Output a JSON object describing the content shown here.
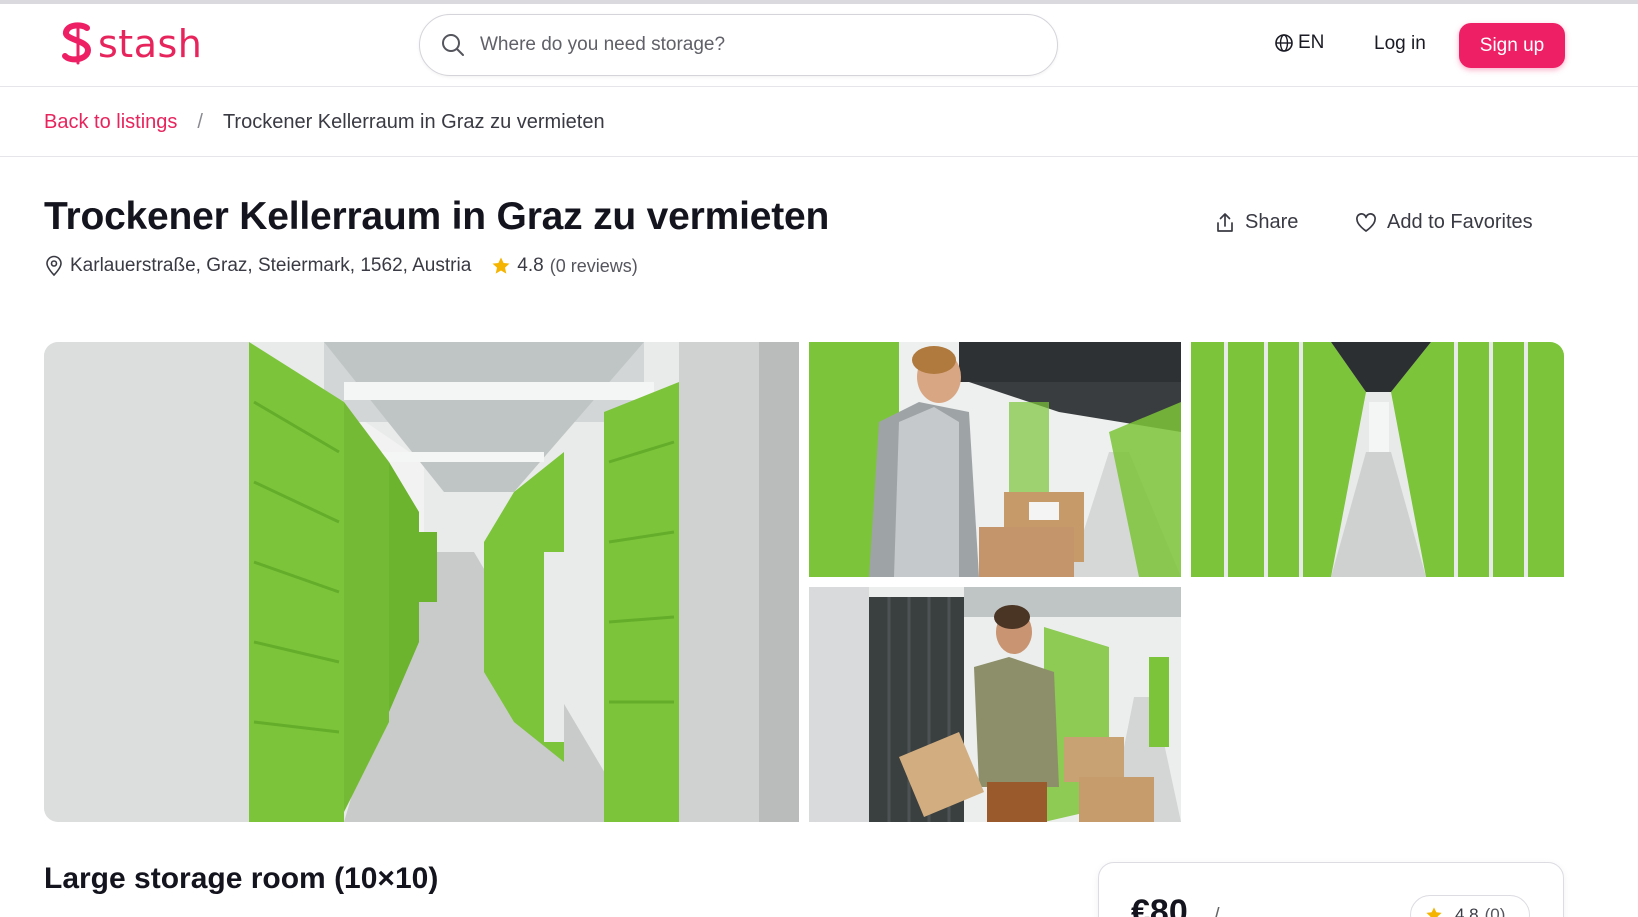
{
  "brand": {
    "name": "stash",
    "color": "#ee1f65"
  },
  "search": {
    "placeholder": "Where do you need storage?"
  },
  "header": {
    "language": "EN",
    "login_label": "Log in",
    "signup_label": "Sign up"
  },
  "breadcrumb": {
    "back_label": "Back to listings",
    "separator": "/",
    "current": "Trockener Kellerraum in Graz zu vermieten"
  },
  "listing": {
    "title": "Trockener Kellerraum in Graz zu vermieten",
    "address": "Karlauerstraße, Graz, Steiermark, 1562, Austria",
    "rating": "4.8",
    "reviews": "(0 reviews)",
    "share_label": "Share",
    "favorite_label": "Add to Favorites",
    "unit_title": "Large storage room (10×10)"
  },
  "gallery": [
    {
      "icon": "storage-corridor-photo"
    },
    {
      "icon": "man-scanning-boxes-photo"
    },
    {
      "icon": "storage-hallway-photo"
    },
    {
      "icon": "man-carrying-box-photo"
    }
  ],
  "booking_card": {
    "price": "€80",
    "price_unit": "/",
    "rating": "4.8",
    "reviews": "(0)"
  },
  "colors": {
    "accent": "#ee1f65",
    "star": "#f5b400",
    "door_green": "#7cc43a"
  }
}
